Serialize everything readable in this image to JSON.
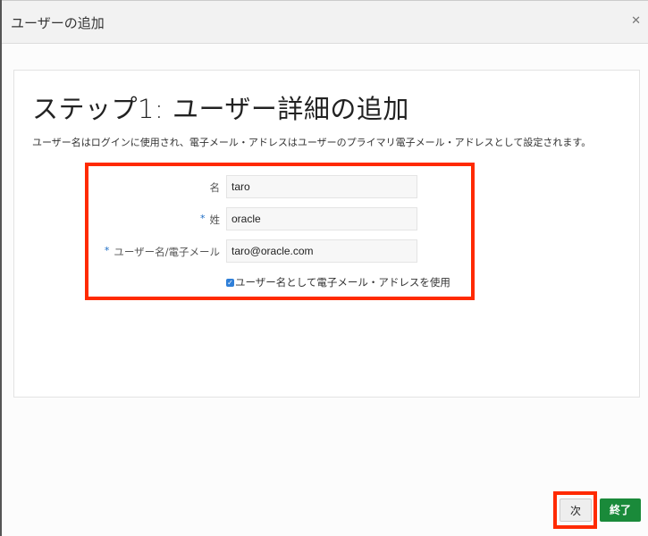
{
  "dialog": {
    "title": "ユーザーの追加",
    "close_icon": "close-icon"
  },
  "step": {
    "title": "ステップ1: ユーザー詳細の追加",
    "description": "ユーザー名はログインに使用され、電子メール・アドレスはユーザーのプライマリ電子メール・アドレスとして設定されます。"
  },
  "form": {
    "first_name": {
      "label": "名",
      "value": "taro",
      "required": false
    },
    "last_name": {
      "label": "姓",
      "value": "oracle",
      "required": true
    },
    "username": {
      "label": "ユーザー名/電子メール",
      "value": "taro@oracle.com",
      "required": true
    },
    "use_email_checkbox": {
      "label": "ユーザー名として電子メール・アドレスを使用",
      "checked": true
    },
    "required_marker": "*"
  },
  "footer": {
    "next_label": "次",
    "finish_label": "終了"
  },
  "colors": {
    "highlight": "#ff2a00",
    "finish_button": "#1a8a3a",
    "required": "#1a6bc4"
  }
}
